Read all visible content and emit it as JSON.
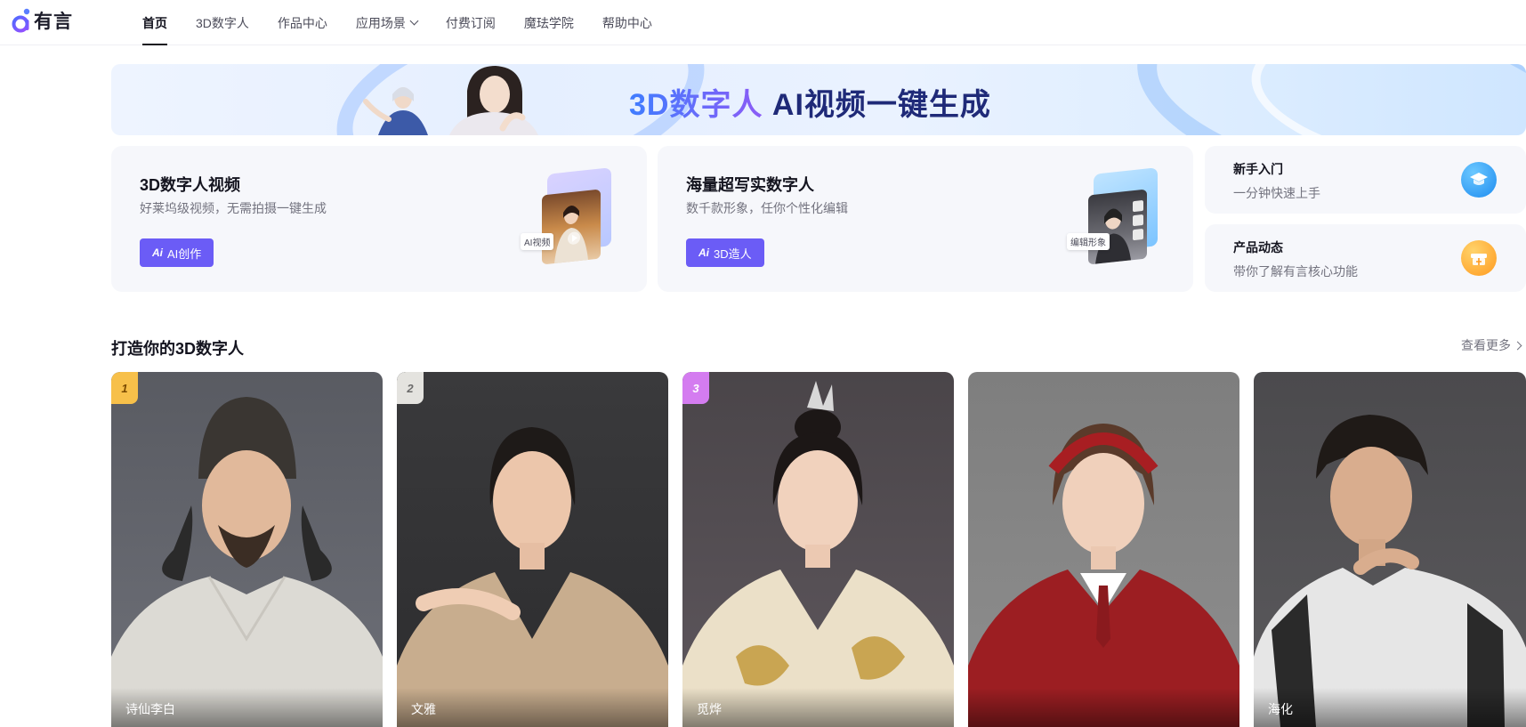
{
  "app": {
    "logo_text": "有言"
  },
  "nav": {
    "items": [
      {
        "label": "首页",
        "active": true
      },
      {
        "label": "3D数字人"
      },
      {
        "label": "作品中心"
      },
      {
        "label": "应用场景",
        "has_dropdown": true
      },
      {
        "label": "付费订阅"
      },
      {
        "label": "魔珐学院"
      },
      {
        "label": "帮助中心"
      }
    ]
  },
  "banner": {
    "title_highlight": "3D数字人",
    "title_rest": " AI视频一键生成"
  },
  "cards": [
    {
      "title": "3D数字人视频",
      "subtitle": "好莱坞级视频，无需拍摄一键生成",
      "button_icon": "Ai",
      "button_label": "AI创作",
      "art_tag": "AI视频"
    },
    {
      "title": "海量超写实数字人",
      "subtitle": "数千款形象，任你个性化编辑",
      "button_icon": "Ai",
      "button_label": "3D造人",
      "art_tag": "编辑形象"
    }
  ],
  "side_cards": [
    {
      "title": "新手入门",
      "subtitle": "一分钟快速上手",
      "icon": "graduation-cap-icon"
    },
    {
      "title": "产品动态",
      "subtitle": "带你了解有言核心功能",
      "icon": "gift-box-icon"
    }
  ],
  "section": {
    "title": "打造你的3D数字人",
    "more_label": "查看更多"
  },
  "avatars": [
    {
      "rank": "1",
      "name": "诗仙李白"
    },
    {
      "rank": "2",
      "name": "文雅"
    },
    {
      "rank": "3",
      "name": "觅烨"
    },
    {
      "rank": "",
      "name": ""
    },
    {
      "rank": "",
      "name": "海化"
    }
  ],
  "colors": {
    "accent": "#6b5cf6",
    "rank_gold": "#f7c04a",
    "rank_silver": "#e4e3df",
    "rank_purple": "#d47cf0"
  }
}
